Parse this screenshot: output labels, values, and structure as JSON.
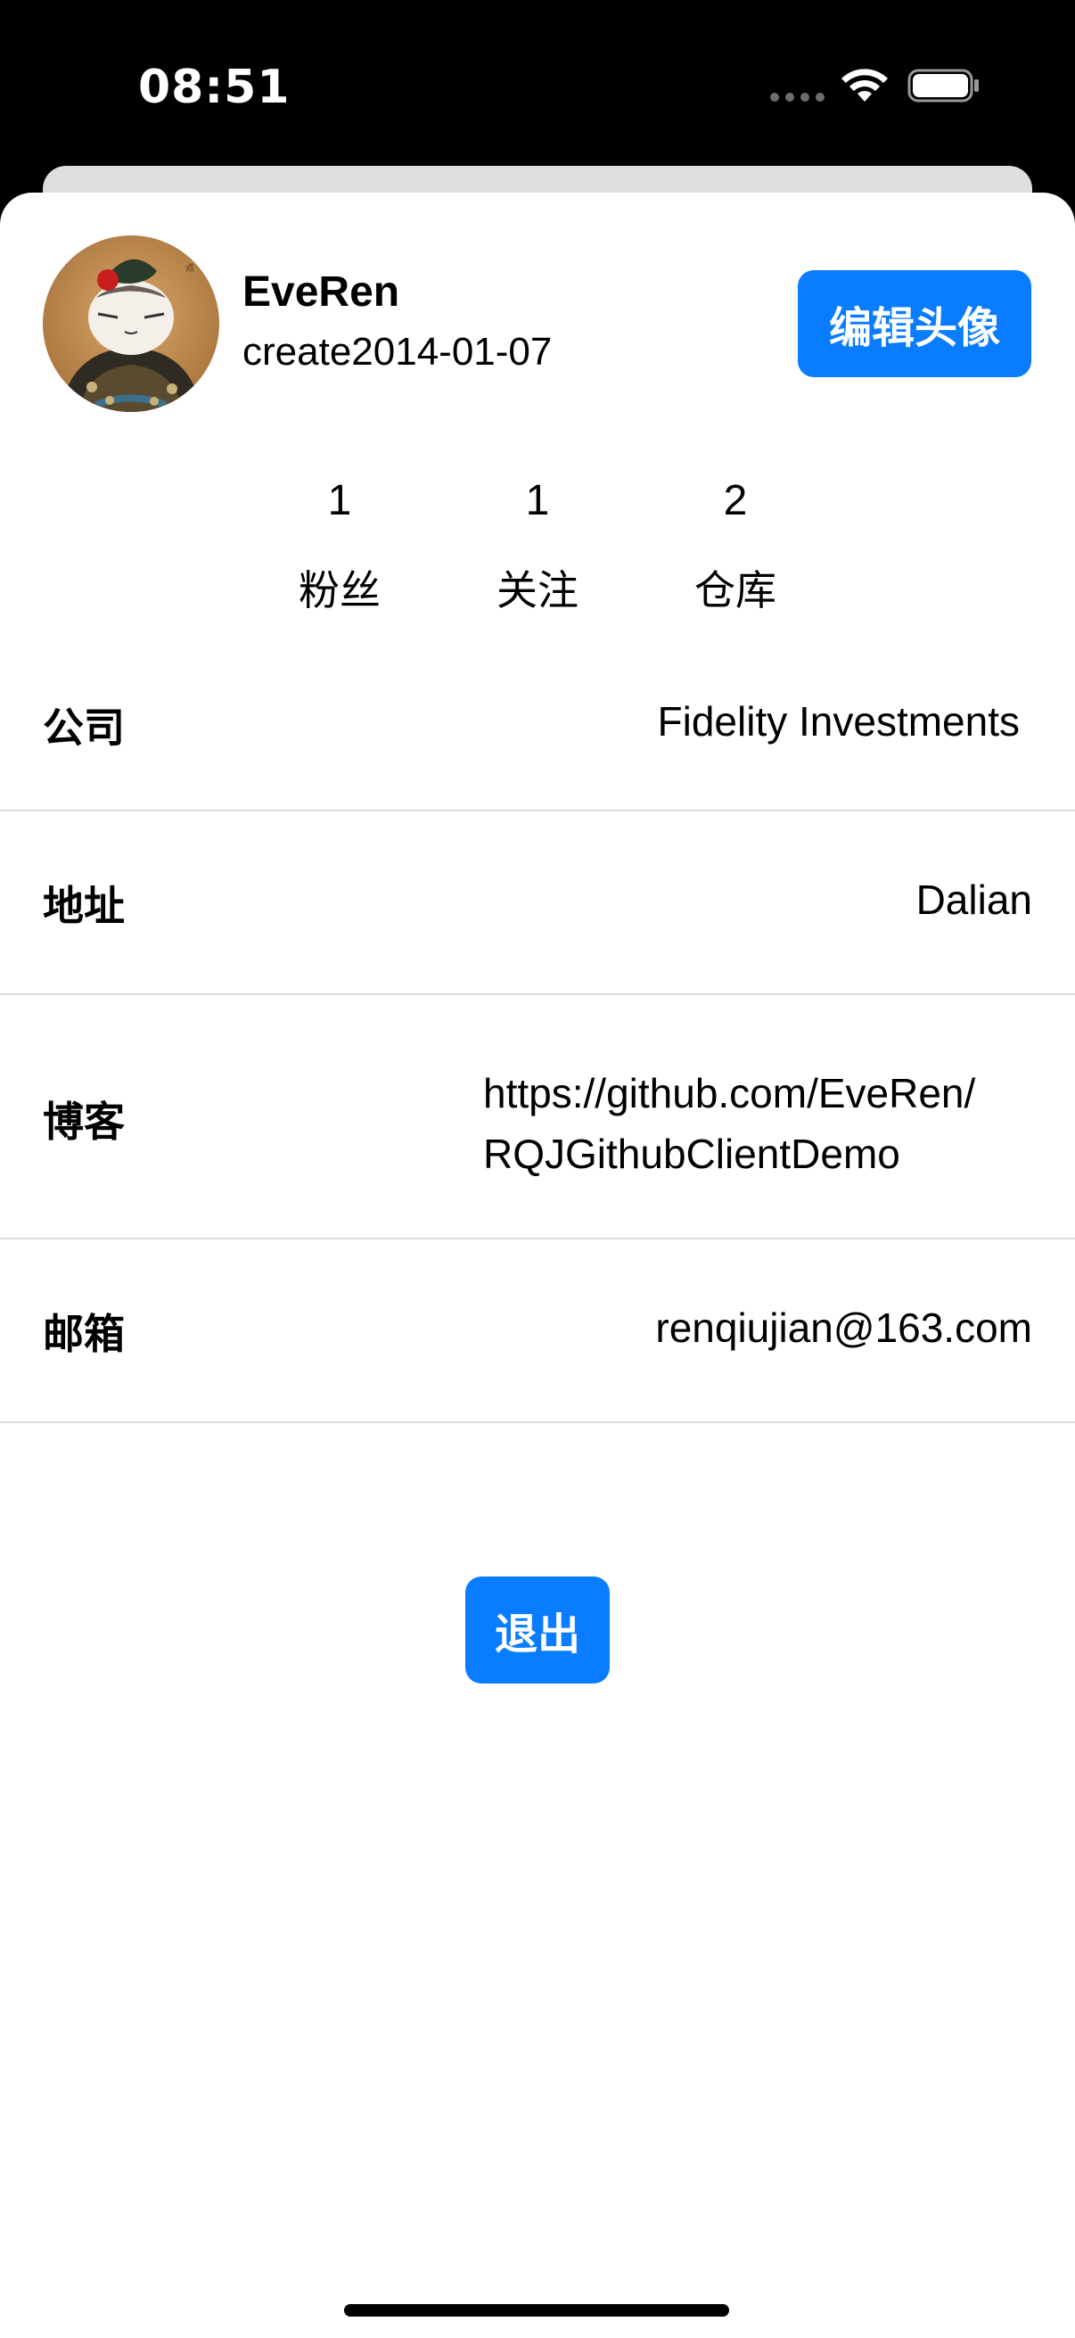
{
  "status_bar": {
    "time": "08:51",
    "wifi_icon": "wifi-icon",
    "battery_icon": "battery-icon"
  },
  "profile": {
    "avatar_icon": "avatar-image",
    "username": "EveRen",
    "created": "create2014-01-07",
    "edit_avatar_label": "编辑头像"
  },
  "stats": [
    {
      "value": "1",
      "label": "粉丝"
    },
    {
      "value": "1",
      "label": "关注"
    },
    {
      "value": "2",
      "label": "仓库"
    }
  ],
  "info": {
    "company": {
      "label": "公司",
      "value": "Fidelity Investments"
    },
    "address": {
      "label": "地址",
      "value": "Dalian"
    },
    "blog": {
      "label": "博客",
      "value_line1": "https://github.com/EveRen/",
      "value_line2": "RQJGithubClientDemo"
    },
    "email": {
      "label": "邮箱",
      "value": "renqiujian@163.com"
    }
  },
  "actions": {
    "logout_label": "退出"
  },
  "colors": {
    "accent": "#0a7cff",
    "divider": "#dcdcdc",
    "background": "#ffffff"
  }
}
